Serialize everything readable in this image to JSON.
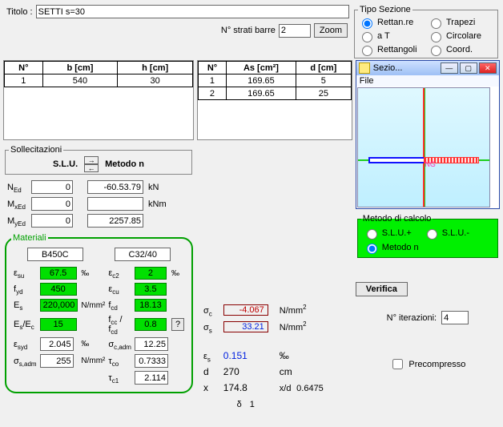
{
  "header": {
    "title_label": "Titolo :",
    "title_value": "SETTI s=30",
    "strati_label": "N° strati barre",
    "strati_value": "2",
    "zoom_btn": "Zoom"
  },
  "section_type": {
    "legend": "Tipo Sezione",
    "opts": [
      "Rettan.re",
      "Trapezi",
      "a T",
      "Circolare",
      "Rettangoli",
      "Coord."
    ],
    "selected": 0
  },
  "tbl_left": {
    "headers": [
      "N°",
      "b [cm]",
      "h [cm]"
    ],
    "rows": [
      [
        "1",
        "540",
        "30"
      ]
    ]
  },
  "tbl_mid": {
    "headers": [
      "N°",
      "As [cm²]",
      "d [cm]"
    ],
    "rows": [
      [
        "1",
        "169.65",
        "5"
      ],
      [
        "2",
        "169.65",
        "25"
      ]
    ]
  },
  "sollec": {
    "legend": "Sollecitazioni",
    "left_label": "S.L.U.",
    "right_label": "Metodo n",
    "rows": [
      {
        "sym": "N",
        "sub": "Ed",
        "left": "0",
        "right": "-60.53.79",
        "unit": "kN"
      },
      {
        "sym": "M",
        "sub": "xEd",
        "left": "0",
        "right": "",
        "unit": "kNm"
      },
      {
        "sym": "M",
        "sub": "yEd",
        "left": "0",
        "right": "2257.85",
        "unit": ""
      }
    ]
  },
  "materials": {
    "legend": "Materiali",
    "steel": "B450C",
    "conc": "C32/40",
    "rows": [
      {
        "l_sym": "ε",
        "l_sub": "su",
        "l_val": "67.5",
        "l_unit": "‰",
        "r_sym": "ε",
        "r_sub": "c2",
        "r_val": "2",
        "r_unit": "‰"
      },
      {
        "l_sym": "f",
        "l_sub": "yd",
        "l_val": "450",
        "l_unit": "",
        "r_sym": "ε",
        "r_sub": "cu",
        "r_val": "3.5",
        "r_unit": ""
      },
      {
        "l_sym": "E",
        "l_sub": "s",
        "l_val": "220,000",
        "l_unit": "N/mm²",
        "r_sym": "f",
        "r_sub": "cd",
        "r_val": "18.13",
        "r_unit": ""
      },
      {
        "l_sym": "E",
        "l_sub": "s",
        "l_sym2": "/E",
        "l_sub2": "c",
        "l_val": "15",
        "l_unit": "",
        "r_sym": "f",
        "r_sub": "cc",
        "r_sym2": "/ f",
        "r_sub2": "cd",
        "r_val": "0.8",
        "r_unit": "",
        "r_q": "?"
      },
      {
        "l_sym": "ε",
        "l_sub": "syd",
        "l_val": "2.045",
        "l_unit": "‰",
        "r_sym": "σ",
        "r_sub": "c,adm",
        "r_val": "12.25",
        "r_unit": "",
        "plain_left": true,
        "plain_right": true
      },
      {
        "l_sym": "σ",
        "l_sub": "s,adm",
        "l_val": "255",
        "l_unit": "N/mm²",
        "r_sym": "τ",
        "r_sub": "co",
        "r_val": "0.7333",
        "r_unit": "",
        "plain_left": true,
        "plain_right": true
      },
      {
        "only_right": true,
        "r_sym": "τ",
        "r_sub": "c1",
        "r_val": "2.114",
        "plain_right": true
      }
    ]
  },
  "calc": {
    "legend": "Metodo di calcolo",
    "opts": [
      "S.L.U.+",
      "S.L.U.-",
      "Metodo n"
    ],
    "selected": 2
  },
  "results": {
    "sigma_c": {
      "sym": "σ",
      "sub": "c",
      "val": "-4.067",
      "unit": "N/mm",
      "sup": "2"
    },
    "sigma_s": {
      "sym": "σ",
      "sub": "s",
      "val": "33.21",
      "unit": "N/mm",
      "sup": "2"
    },
    "eps_s": {
      "sym": "ε",
      "sub": "s",
      "val": "0.151",
      "unit": "‰"
    },
    "d": {
      "sym": "d",
      "val": "270",
      "unit": "cm"
    },
    "x": {
      "sym": "x",
      "val": "174.8",
      "sym2": "x/d",
      "val2": "0.6475"
    },
    "delta": {
      "sym": "δ",
      "val": "1"
    }
  },
  "verify_btn": "Verifica",
  "niter_label": "N° iterazioni:",
  "niter_val": "4",
  "precomp": "Precompresso",
  "secwin": {
    "title": "Sezio...",
    "menu_file": "File"
  }
}
